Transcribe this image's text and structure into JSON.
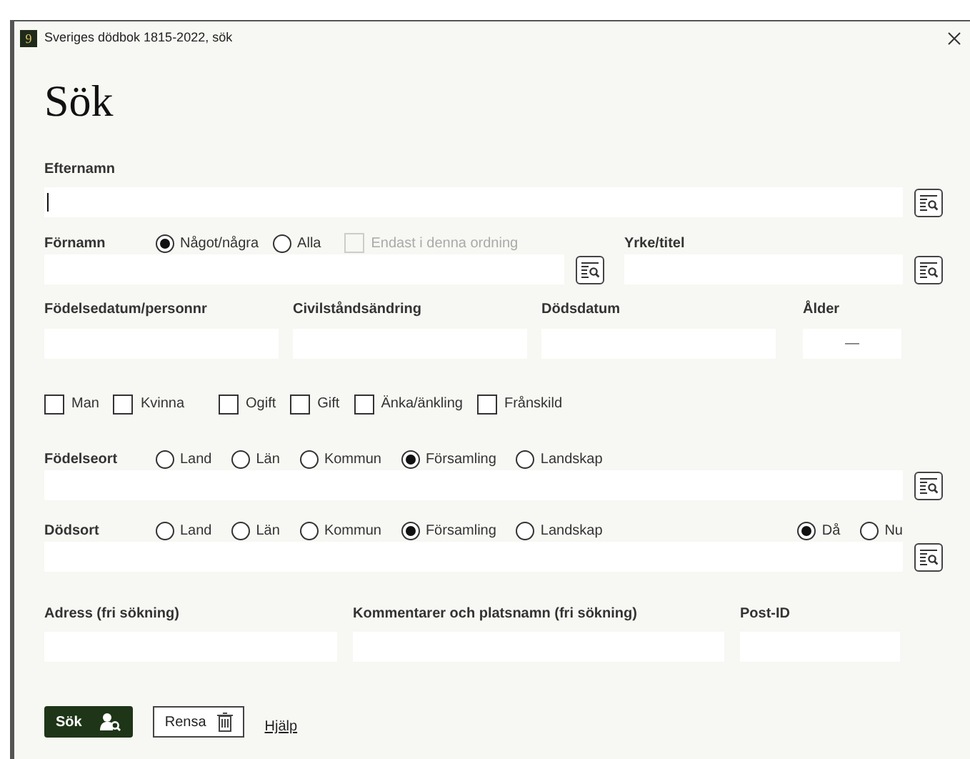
{
  "window": {
    "title": "Sveriges dödbok 1815-2022, sök",
    "logo": "9"
  },
  "heading": "Sök",
  "surname": {
    "label": "Efternamn"
  },
  "first_name": {
    "label": "Förnamn",
    "options": [
      {
        "label": "Något/några",
        "selected": true
      },
      {
        "label": "Alla",
        "selected": false
      }
    ],
    "exact_order": {
      "label": "Endast i denna ordning",
      "checked": false,
      "disabled": true
    }
  },
  "occupation": {
    "label": "Yrke/titel"
  },
  "date_fields": [
    {
      "label": "Födelsedatum/personnr"
    },
    {
      "label": "Civilståndsändring"
    },
    {
      "label": "Dödsdatum"
    }
  ],
  "age": {
    "label": "Ålder",
    "separator": "—"
  },
  "checkbox_groups": [
    [
      {
        "label": "Man",
        "checked": false
      },
      {
        "label": "Kvinna",
        "checked": false
      }
    ],
    [
      {
        "label": "Ogift",
        "checked": false
      },
      {
        "label": "Gift",
        "checked": false
      },
      {
        "label": "Änka/änkling",
        "checked": false
      },
      {
        "label": "Frånskild",
        "checked": false
      }
    ]
  ],
  "birth_place": {
    "label": "Födelseort",
    "options": [
      {
        "label": "Land",
        "selected": false
      },
      {
        "label": "Län",
        "selected": false
      },
      {
        "label": "Kommun",
        "selected": false
      },
      {
        "label": "Församling",
        "selected": true
      },
      {
        "label": "Landskap",
        "selected": false
      }
    ]
  },
  "death_place": {
    "label": "Dödsort",
    "options": [
      {
        "label": "Land",
        "selected": false
      },
      {
        "label": "Län",
        "selected": false
      },
      {
        "label": "Kommun",
        "selected": false
      },
      {
        "label": "Församling",
        "selected": true
      },
      {
        "label": "Landskap",
        "selected": false
      }
    ],
    "time_options": [
      {
        "label": "Då",
        "selected": true
      },
      {
        "label": "Nu",
        "selected": false
      }
    ]
  },
  "free_fields": [
    {
      "label": "Adress (fri sökning)"
    },
    {
      "label": "Kommentarer och platsnamn (fri sökning)"
    },
    {
      "label": "Post-ID"
    }
  ],
  "buttons": {
    "search": "Sök",
    "clear": "Rensa",
    "help": "Hjälp"
  }
}
